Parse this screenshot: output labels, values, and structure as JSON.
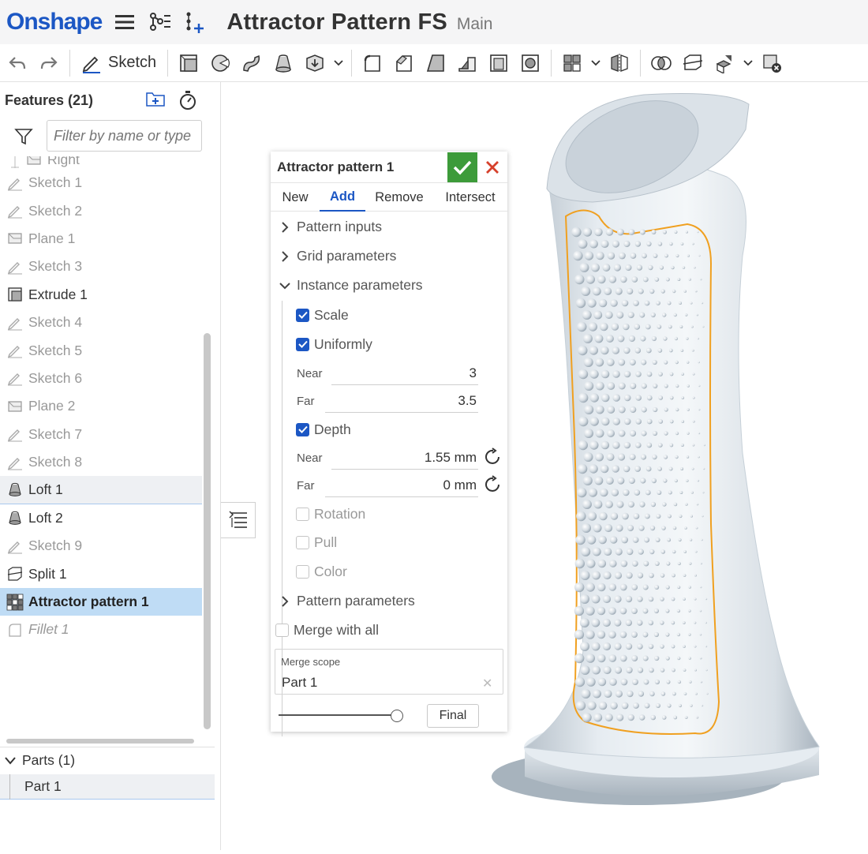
{
  "app": {
    "logo": "Onshape",
    "document_title": "Attractor Pattern FS",
    "branch": "Main"
  },
  "toolbar": {
    "sketch_label": "Sketch"
  },
  "feature_panel": {
    "title": "Features (21)",
    "filter_placeholder": "Filter by name or type",
    "items": [
      {
        "label": "Right",
        "icon": "plane-icon"
      },
      {
        "label": "Sketch 1",
        "icon": "sketch-icon"
      },
      {
        "label": "Sketch 2",
        "icon": "sketch-icon"
      },
      {
        "label": "Plane 1",
        "icon": "plane-icon"
      },
      {
        "label": "Sketch 3",
        "icon": "sketch-icon"
      },
      {
        "label": "Extrude 1",
        "icon": "extrude-icon"
      },
      {
        "label": "Sketch 4",
        "icon": "sketch-icon"
      },
      {
        "label": "Sketch 5",
        "icon": "sketch-icon"
      },
      {
        "label": "Sketch 6",
        "icon": "sketch-icon"
      },
      {
        "label": "Plane 2",
        "icon": "plane-icon"
      },
      {
        "label": "Sketch 7",
        "icon": "sketch-icon"
      },
      {
        "label": "Sketch 8",
        "icon": "sketch-icon"
      },
      {
        "label": "Loft 1",
        "icon": "loft-icon"
      },
      {
        "label": "Loft 2",
        "icon": "loft-icon"
      },
      {
        "label": "Sketch 9",
        "icon": "sketch-icon"
      },
      {
        "label": "Split 1",
        "icon": "split-icon"
      },
      {
        "label": "Attractor pattern 1",
        "icon": "attractor-pattern-icon"
      },
      {
        "label": "Fillet 1",
        "icon": "fillet-icon"
      }
    ],
    "parts_header": "Parts (1)",
    "parts": [
      "Part 1"
    ]
  },
  "dialog": {
    "title": "Attractor pattern 1",
    "tabs": [
      "New",
      "Add",
      "Remove",
      "Intersect"
    ],
    "active_tab": "Add",
    "sections": {
      "pattern_inputs": "Pattern inputs",
      "grid_parameters": "Grid parameters",
      "instance_parameters": "Instance parameters",
      "pattern_parameters": "Pattern parameters"
    },
    "scale": {
      "label": "Scale",
      "checked": true
    },
    "uniformly": {
      "label": "Uniformly",
      "checked": true
    },
    "scale_near": {
      "label": "Near",
      "value": "3"
    },
    "scale_far": {
      "label": "Far",
      "value": "3.5"
    },
    "depth": {
      "label": "Depth",
      "checked": true
    },
    "depth_near": {
      "label": "Near",
      "value": "1.55 mm"
    },
    "depth_far": {
      "label": "Far",
      "value": "0 mm"
    },
    "rotation": {
      "label": "Rotation",
      "checked": false
    },
    "pull": {
      "label": "Pull",
      "checked": false
    },
    "color": {
      "label": "Color",
      "checked": false
    },
    "merge_with_all": {
      "label": "Merge with all",
      "checked": false
    },
    "merge_scope": {
      "label": "Merge scope",
      "value": "Part 1"
    },
    "final_label": "Final"
  },
  "colors": {
    "brand_blue": "#1c57c4",
    "ok_green": "#3d9b3a",
    "cancel_red": "#d6402b",
    "selection_blue": "#bfdcf5",
    "highlight_orange": "#f0a020"
  }
}
